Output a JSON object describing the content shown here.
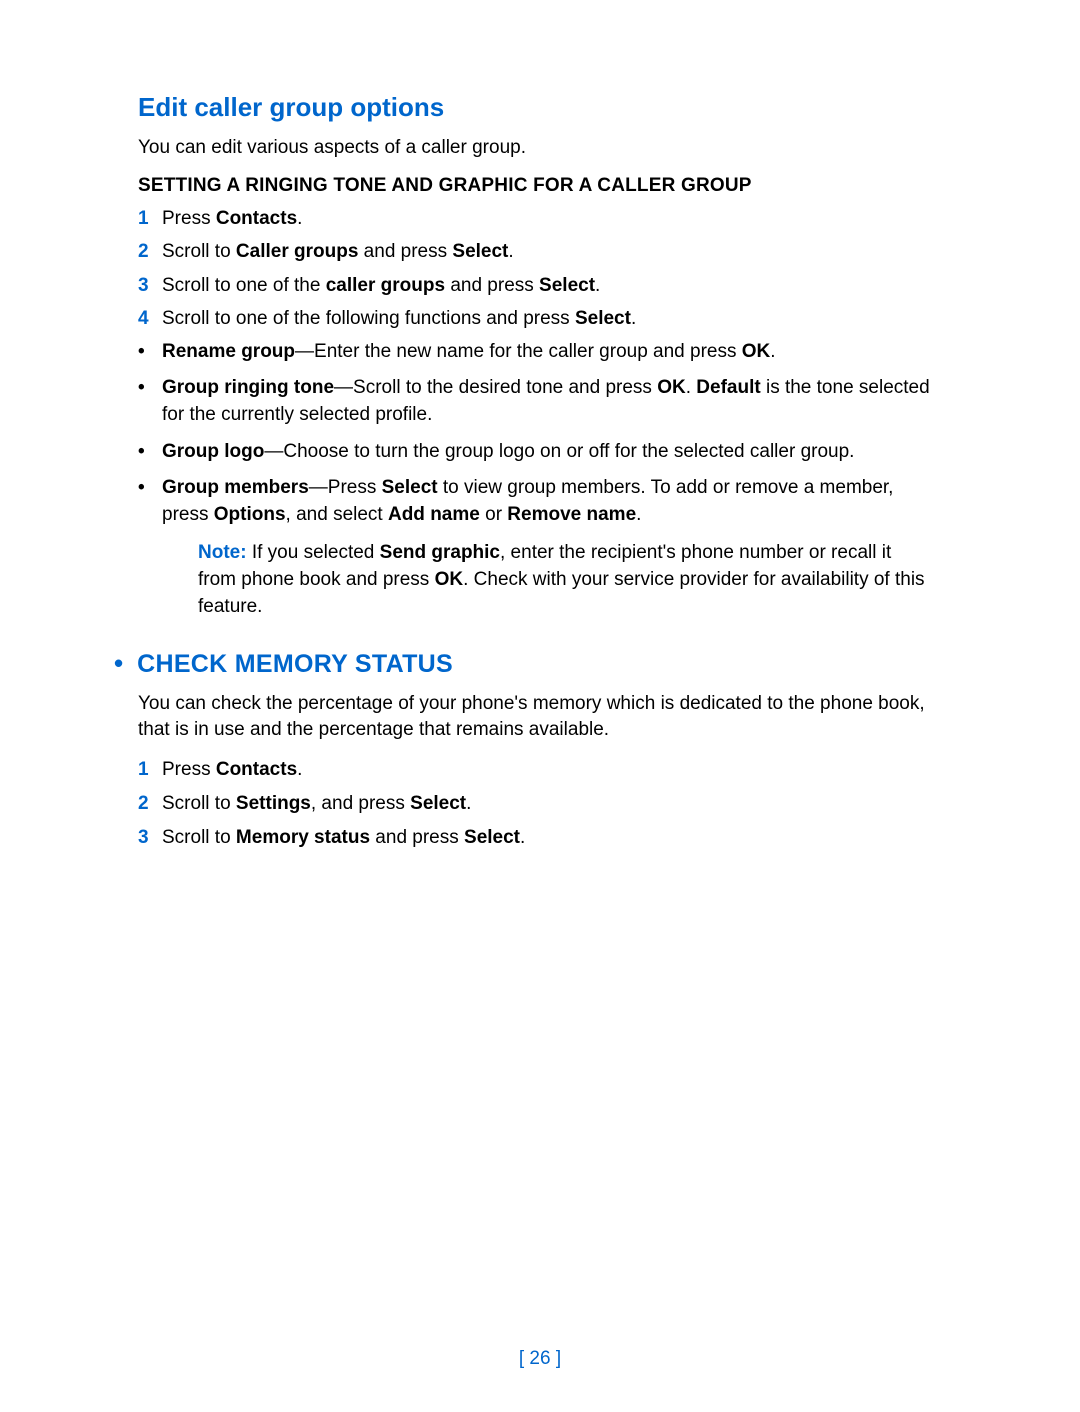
{
  "section1": {
    "title": "Edit caller group options",
    "intro": "You can edit various aspects of a caller group.",
    "subhead": "SETTING A RINGING TONE AND GRAPHIC FOR A CALLER GROUP",
    "steps": [
      {
        "n": "1",
        "pre": "Press ",
        "b1": "Contacts",
        "post": "."
      },
      {
        "n": "2",
        "pre": "Scroll to ",
        "b1": "Caller groups",
        "mid": " and press ",
        "b2": "Select",
        "post": "."
      },
      {
        "n": "3",
        "pre": "Scroll to one of the ",
        "b1": "caller groups",
        "mid": " and press ",
        "b2": "Select",
        "post": "."
      },
      {
        "n": "4",
        "pre": "Scroll to one of the following functions and press ",
        "b1": "Select",
        "post": "."
      }
    ],
    "bullets": [
      {
        "b1": "Rename group",
        "t1": "—Enter the new name for the caller group and press ",
        "b2": "OK",
        "t2": "."
      },
      {
        "b1": "Group ringing tone",
        "t1": "—Scroll to the desired tone and press ",
        "b2": "OK",
        "t2": ". ",
        "b3": "Default",
        "t3": " is the tone selected for the currently selected profile."
      },
      {
        "b1": "Group logo",
        "t1": "—Choose to turn the group logo on or off for the selected caller group."
      },
      {
        "b1": "Group members",
        "t1": "—Press ",
        "b2": "Select",
        "t2": " to view group members. To add or remove a member, press ",
        "b3": "Options",
        "t3": ", and select ",
        "b4": "Add name",
        "t4": " or ",
        "b5": "Remove name",
        "t5": "."
      }
    ],
    "note": {
      "label": "Note:",
      "t1": " If you selected ",
      "b1": "Send graphic",
      "t2": ", enter the recipient's phone number or recall it from phone book and press ",
      "b2": "OK",
      "t3": ". Check with your service provider for availability of this feature."
    }
  },
  "section2": {
    "title": "CHECK MEMORY STATUS",
    "intro": "You can check the percentage of your phone's memory which is dedicated to the phone book, that is in use and the percentage that remains available.",
    "steps": [
      {
        "n": "1",
        "pre": "Press ",
        "b1": "Contacts",
        "post": "."
      },
      {
        "n": "2",
        "pre": "Scroll to ",
        "b1": "Settings",
        "mid": ", and press ",
        "b2": "Select",
        "post": "."
      },
      {
        "n": "3",
        "pre": "Scroll to ",
        "b1": "Memory status",
        "mid": " and press ",
        "b2": "Select",
        "post": "."
      }
    ]
  },
  "pageNumber": "26"
}
